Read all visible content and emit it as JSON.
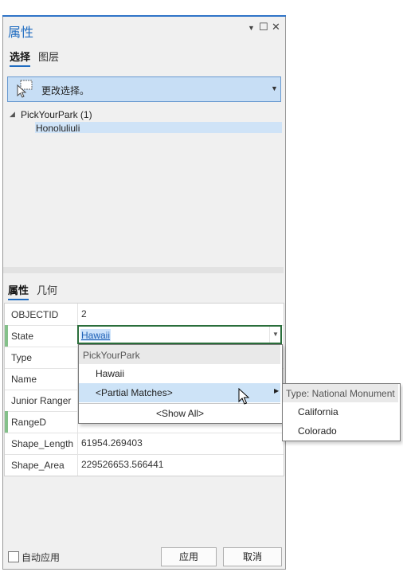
{
  "pane": {
    "title": "属性"
  },
  "top_tabs": [
    "选择",
    "图层"
  ],
  "selection": {
    "text": "更改选择。"
  },
  "tree": {
    "root": "PickYourPark (1)",
    "child": "Honoluliuli"
  },
  "attr_tabs": [
    "属性",
    "几何"
  ],
  "attributes": {
    "rows": [
      {
        "label": "OBJECTID",
        "value": "2"
      },
      {
        "label": "State",
        "value": "Hawaii"
      },
      {
        "label": "Type",
        "value": ""
      },
      {
        "label": "Name",
        "value": ""
      },
      {
        "label": "Junior Ranger",
        "value": ""
      },
      {
        "label": "RangeD",
        "value": ""
      },
      {
        "label": "Shape_Length",
        "value": "61954.269403"
      },
      {
        "label": "Shape_Area",
        "value": "229526653.566441"
      }
    ]
  },
  "dropdown": {
    "header": "PickYourPark",
    "items": [
      "Hawaii",
      "<Partial Matches>"
    ],
    "show_all": "<Show All>"
  },
  "submenu": {
    "header": "Type: National Monument",
    "items": [
      "California",
      "Colorado"
    ]
  },
  "footer": {
    "auto_apply": "自动应用",
    "apply": "应用",
    "cancel": "取消"
  },
  "colors": {
    "accent": "#1f6cc1",
    "selection": "#c7def5",
    "required": "#84c08a"
  }
}
